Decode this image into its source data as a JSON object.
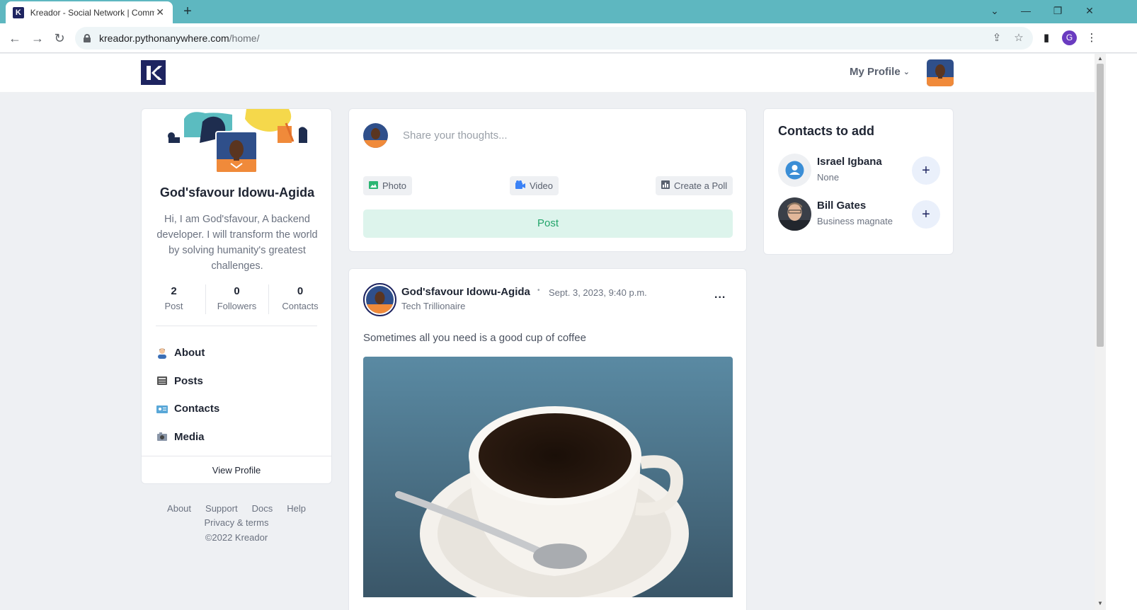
{
  "browser": {
    "tab_title": "Kreador - Social Network | Comm",
    "url_host": "kreador.pythonanywhere.com",
    "url_path": "/home/",
    "profile_initial": "G"
  },
  "header": {
    "my_profile_label": "My Profile"
  },
  "profile": {
    "name": "God'sfavour Idowu-Agida",
    "bio": "Hi, I am God'sfavour, A backend developer. I will transform the world by solving humanity's greatest challenges.",
    "stats": [
      {
        "value": "2",
        "label": "Post"
      },
      {
        "value": "0",
        "label": "Followers"
      },
      {
        "value": "0",
        "label": "Contacts"
      }
    ],
    "menu": [
      {
        "label": "About",
        "icon": "person-icon"
      },
      {
        "label": "Posts",
        "icon": "newspaper-icon"
      },
      {
        "label": "Contacts",
        "icon": "id-card-icon"
      },
      {
        "label": "Media",
        "icon": "media-icon"
      }
    ],
    "view_profile_label": "View Profile"
  },
  "footer": {
    "links": [
      "About",
      "Support",
      "Docs",
      "Help",
      "Privacy & terms"
    ],
    "copyright": "©2022 Kreador"
  },
  "composer": {
    "placeholder": "Share your thoughts...",
    "photo_label": "Photo",
    "video_label": "Video",
    "poll_label": "Create a Poll",
    "post_label": "Post"
  },
  "post": {
    "author": "God'sfavour Idowu-Agida",
    "timestamp": "Sept. 3, 2023, 9:40 p.m.",
    "subtitle": "Tech Trillionaire",
    "text": "Sometimes all you need is a good cup of coffee",
    "more_label": "..."
  },
  "contacts": {
    "title": "Contacts to add",
    "items": [
      {
        "name": "Israel Igbana",
        "subtitle": "None"
      },
      {
        "name": "Bill Gates",
        "subtitle": "Business magnate"
      }
    ],
    "add_label": "+"
  }
}
